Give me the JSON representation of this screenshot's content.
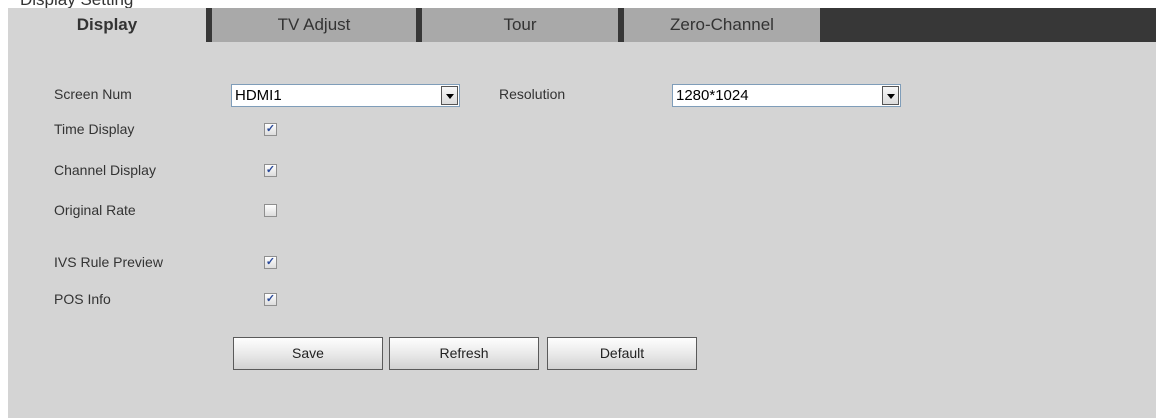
{
  "header_text": "Display Setting",
  "tabs": [
    {
      "label": "Display",
      "active": true
    },
    {
      "label": "TV Adjust",
      "active": false
    },
    {
      "label": "Tour",
      "active": false
    },
    {
      "label": "Zero-Channel",
      "active": false
    }
  ],
  "form": {
    "screen_num": {
      "label": "Screen Num",
      "value": "HDMI1"
    },
    "resolution": {
      "label": "Resolution",
      "value": "1280*1024"
    },
    "options": [
      {
        "label": "Time Display",
        "checked": true
      },
      {
        "label": "Channel Display",
        "checked": true
      },
      {
        "label": "Original Rate",
        "checked": false
      },
      {
        "label": "IVS Rule Preview",
        "checked": true
      },
      {
        "label": "POS Info",
        "checked": true
      }
    ]
  },
  "buttons": {
    "save": "Save",
    "refresh": "Refresh",
    "default": "Default"
  },
  "colors": {
    "tab_bar": "#373737",
    "tab_inactive": "#a9a9a9",
    "panel": "#d4d4d4",
    "check_mark": "#2a4a9a"
  },
  "icons": {
    "dropdown": "chevron-down-icon",
    "checkbox_checked": "checkmark-icon"
  }
}
